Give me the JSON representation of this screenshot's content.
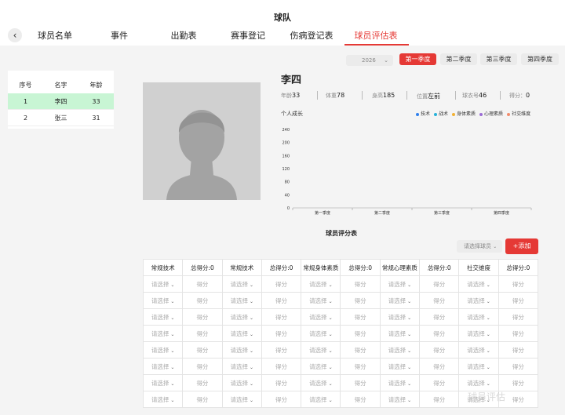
{
  "header": {
    "title": "球队",
    "back_icon": "chevron-left-icon"
  },
  "tabs": [
    {
      "label": "球员名单",
      "active": false
    },
    {
      "label": "事件",
      "active": false
    },
    {
      "label": "出勤表",
      "active": false
    },
    {
      "label": "赛事登记",
      "active": false
    },
    {
      "label": "伤病登记表",
      "active": false
    },
    {
      "label": "球员评估表",
      "active": true
    }
  ],
  "roster": {
    "columns": [
      "序号",
      "名字",
      "年龄"
    ],
    "rows": [
      {
        "no": "1",
        "name": "李四",
        "age": "33",
        "selected": true
      },
      {
        "no": "2",
        "name": "张三",
        "age": "31",
        "selected": false
      }
    ]
  },
  "season": {
    "year": "2026",
    "buttons": [
      {
        "label": "第一季度",
        "active": true
      },
      {
        "label": "第二季度",
        "active": false
      },
      {
        "label": "第三季度",
        "active": false
      },
      {
        "label": "第四季度",
        "active": false
      }
    ]
  },
  "player": {
    "name": "李四",
    "stats": [
      {
        "label": "年龄",
        "value": "33"
      },
      {
        "label": "体重",
        "value": "78"
      },
      {
        "label": "身高",
        "value": "185"
      },
      {
        "label": "位置",
        "value": "左前"
      },
      {
        "label": "球衣号",
        "value": "46"
      },
      {
        "label": "得分：",
        "value": "0"
      }
    ]
  },
  "growth": {
    "title": "个人成长",
    "legend": [
      {
        "name": "技术",
        "color": "#2f80ed"
      },
      {
        "name": "战术",
        "color": "#27b1d9"
      },
      {
        "name": "身体素质",
        "color": "#f2b134"
      },
      {
        "name": "心理素质",
        "color": "#9b6cd6"
      },
      {
        "name": "社交维度",
        "color": "#f28c6c"
      }
    ]
  },
  "chart_data": {
    "type": "line",
    "categories": [
      "第一季度",
      "第二季度",
      "第三季度",
      "第四季度"
    ],
    "series": [
      {
        "name": "技术",
        "values": []
      },
      {
        "name": "战术",
        "values": []
      },
      {
        "name": "身体素质",
        "values": []
      },
      {
        "name": "心理素质",
        "values": []
      },
      {
        "name": "社交维度",
        "values": []
      }
    ],
    "yticks": [
      0,
      40,
      80,
      120,
      160,
      200,
      240
    ],
    "ylim": [
      0,
      240
    ],
    "xlabel": "",
    "ylabel": "",
    "title": ""
  },
  "scores": {
    "title": "球员评分表",
    "player_select_placeholder": "请选择球员",
    "add_label": "+添加",
    "headers": [
      "常规技术",
      "总得分:0",
      "常规技术",
      "总得分:0",
      "常规身体素质",
      "总得分:0",
      "常规心理素质",
      "总得分:0",
      "社交维度",
      "总得分:0"
    ],
    "select_placeholder": "请选择",
    "score_placeholder": "得分",
    "row_count": 8
  },
  "watermark": "球员评估"
}
